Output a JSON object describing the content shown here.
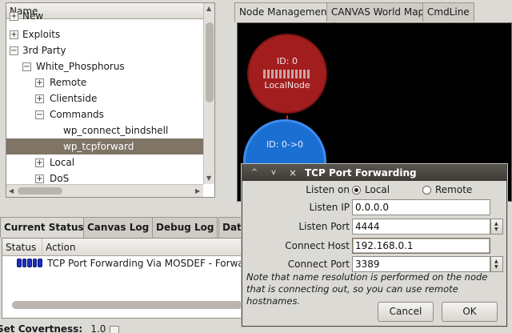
{
  "tree": {
    "header": "Name",
    "rows": [
      {
        "label": "New",
        "expander": "+"
      },
      {
        "label": "Exploits",
        "expander": "+"
      },
      {
        "label": "3rd Party",
        "expander": "−"
      },
      {
        "label": "White_Phosphorus",
        "expander": "−"
      },
      {
        "label": "Remote",
        "expander": "+"
      },
      {
        "label": "Clientside",
        "expander": "+"
      },
      {
        "label": "Commands",
        "expander": "−"
      },
      {
        "label": "wp_connect_bindshell",
        "expander": ""
      },
      {
        "label": "wp_tcpforward",
        "expander": "",
        "selected": true
      },
      {
        "label": "Local",
        "expander": "+"
      },
      {
        "label": "DoS",
        "expander": "+"
      }
    ]
  },
  "right_tabs": [
    "Node Management",
    "CANVAS World Map",
    "CmdLine"
  ],
  "nodes": {
    "local": {
      "id": "ID: 0",
      "name": "LocalNode"
    },
    "remote": {
      "id": "ID: 0->0"
    }
  },
  "bottom_tabs": [
    "Current Status",
    "Canvas Log",
    "Debug Log",
    "Dat"
  ],
  "status_table": {
    "columns": [
      "Status",
      "Action"
    ],
    "rows": [
      {
        "action": "TCP Port Forwarding Via MOSDEF - Forward"
      }
    ]
  },
  "covertness": {
    "label": "Set Covertness:",
    "value": "1.0"
  },
  "dialog": {
    "title": "TCP Port Forwarding",
    "title_buttons": [
      "^",
      "v",
      "×"
    ],
    "listen_on_label": "Listen on",
    "listen_options": [
      "Local",
      "Remote"
    ],
    "selected_option": "Local",
    "fields": [
      {
        "label": "Listen IP",
        "value": "0.0.0.0"
      },
      {
        "label": "Listen Port",
        "value": "4444"
      },
      {
        "label": "Connect Host",
        "value": "192.168.0.1"
      },
      {
        "label": "Connect Port",
        "value": "3389"
      }
    ],
    "note": "Note that name resolution is performed on the node that is connecting out, so you can use remote hostnames.",
    "cancel_label": "Cancel",
    "ok_label": "OK"
  }
}
